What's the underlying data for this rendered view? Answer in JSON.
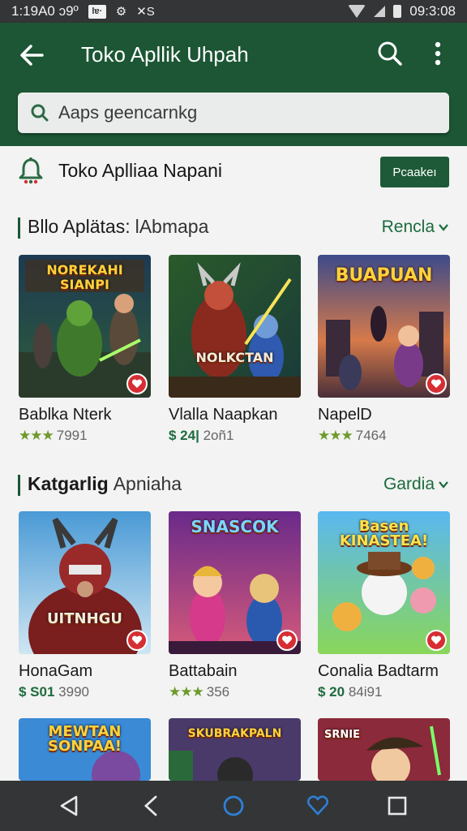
{
  "status_bar": {
    "time_left": "1:19A0 ɔ9º",
    "icon_box": "lɐ·",
    "icon_glyph": "⚙",
    "icon_glyph2": "✕S",
    "time_right": "09:3:08"
  },
  "app_bar": {
    "title": "Toko Apllik Uhpah",
    "search_placeholder": "Aaps geencarnkg",
    "color": "#1c5634"
  },
  "store_row": {
    "title": "Toko Aplliaa Napani",
    "button_label": "Pcaakeı"
  },
  "sections": [
    {
      "title": "Bllo Aplätas:",
      "subtitle": "lAbmapa",
      "link": "Rencla",
      "items": [
        {
          "name": "Bablka Nterk",
          "stars": "★★★",
          "meta": "7991",
          "price": "",
          "caption": "NOREKAHI SIANPI",
          "caption_pos": "top"
        },
        {
          "name": "Vlalla Naapkan",
          "stars": "",
          "meta": "2oñ1",
          "price": "$ 24|",
          "caption": "NOLKCTAN",
          "caption_pos": "bottom"
        },
        {
          "name": "NapelD",
          "stars": "★★★",
          "meta": "7464",
          "price": "",
          "caption": "BUAPUAN",
          "caption_pos": "top"
        }
      ]
    },
    {
      "title": "Katgarlig",
      "subtitle": "Apniaha",
      "link": "Gardia",
      "items": [
        {
          "name": "HonaGam",
          "stars": "",
          "meta": "3990",
          "price": "$ S01",
          "caption": "UITNHGU",
          "caption_pos": "bottom"
        },
        {
          "name": "Battabain",
          "stars": "★★★",
          "meta": "356",
          "price": "",
          "caption": "SNASCOK",
          "caption_pos": "top"
        },
        {
          "name": "Conalia Badtarm",
          "stars": "",
          "meta": "84i91",
          "price": "$ 20",
          "caption": "Basen KINASTEA!",
          "caption_pos": "top"
        }
      ]
    },
    {
      "items": [
        {
          "caption": "MEWTAN SONPAA!",
          "caption_pos": "top"
        },
        {
          "caption": "SKUBRAKPALN",
          "caption_pos": "top"
        },
        {
          "caption": "SRNIE",
          "caption_pos": "top"
        }
      ]
    }
  ],
  "nav_bar": {
    "icons": [
      "back-triangle-icon",
      "back-chevron-icon",
      "home-circle-icon",
      "heart-outline-icon",
      "recents-square-icon"
    ]
  },
  "colors": {
    "accent": "#1c5634",
    "link": "#1d6b3e",
    "badge": "#d62e33",
    "home_icon": "#2f7fd6"
  }
}
